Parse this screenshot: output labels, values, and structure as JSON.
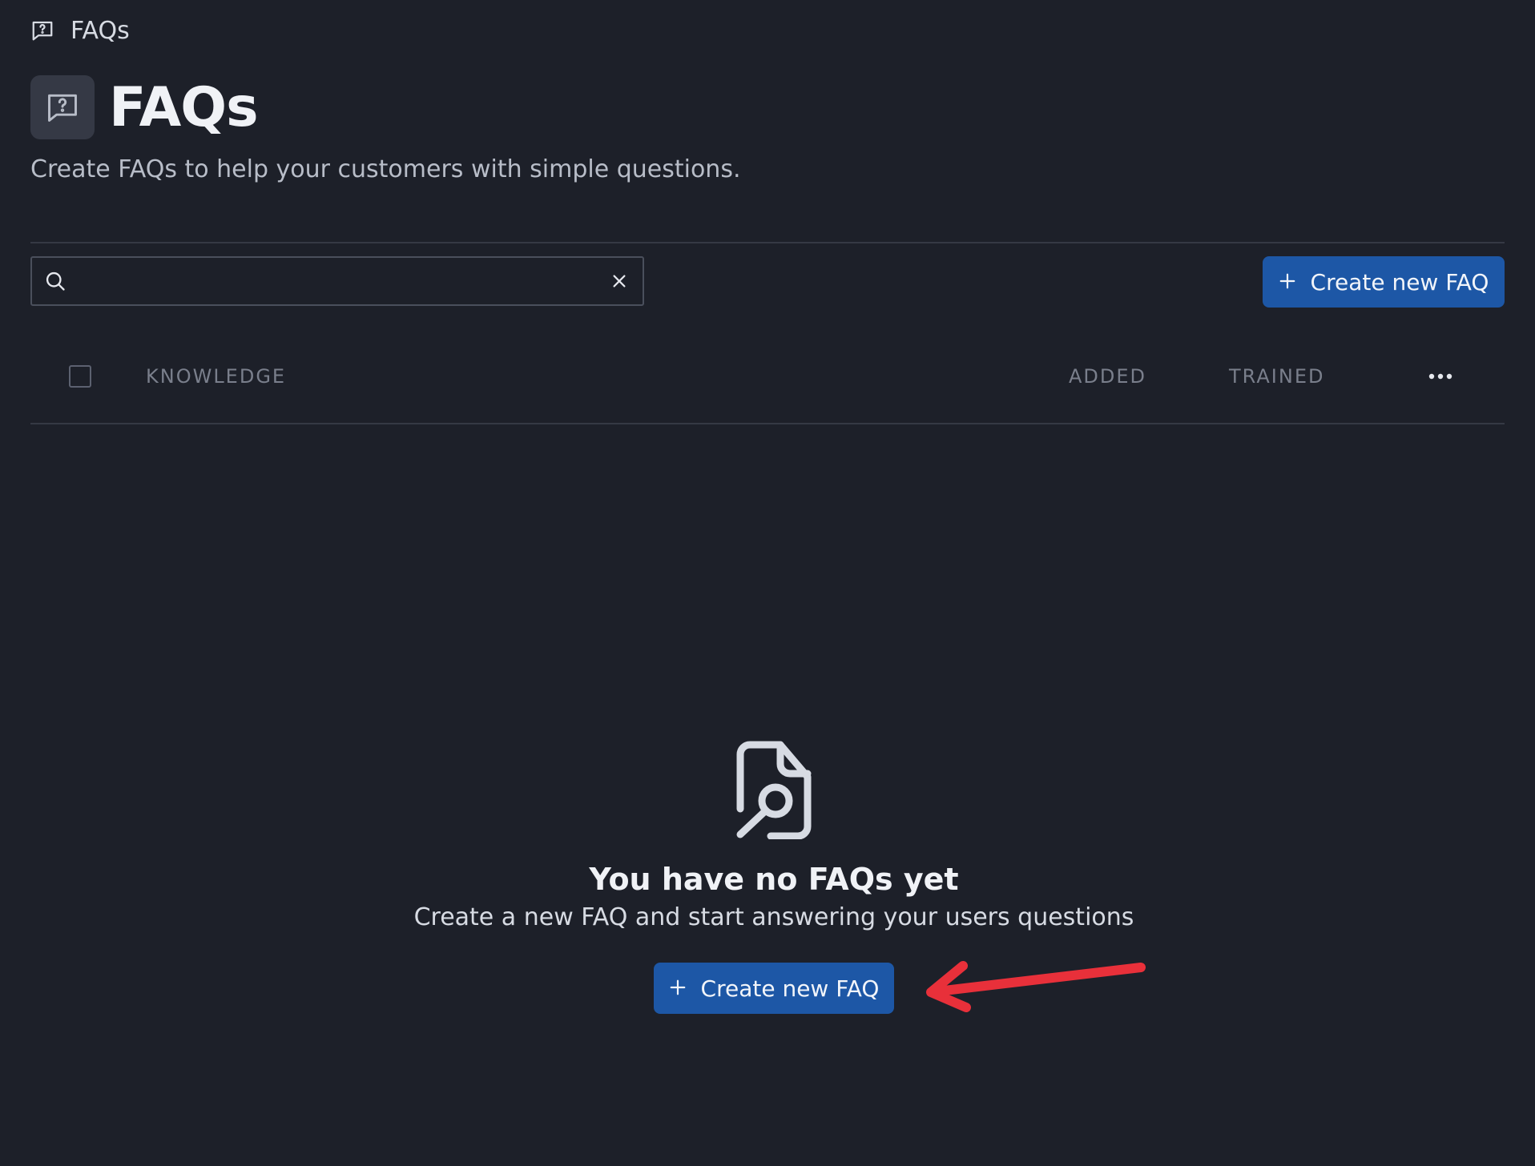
{
  "breadcrumb": {
    "label": "FAQs",
    "icon": "faq-icon"
  },
  "header": {
    "title": "FAQs",
    "subtitle": "Create FAQs to help your customers with simple questions."
  },
  "search": {
    "value": "",
    "placeholder": ""
  },
  "toolbar": {
    "create_label": "Create new FAQ"
  },
  "table": {
    "columns": [
      "KNOWLEDGE",
      "ADDED",
      "TRAINED"
    ]
  },
  "empty_state": {
    "icon": "file-search-icon",
    "title": "You have no FAQs yet",
    "description": "Create a new FAQ and start answering your users questions",
    "button_label": "Create new FAQ"
  },
  "colors": {
    "background": "#1d2029",
    "primary_button": "#1d57a6",
    "annotation_arrow": "#e8303a"
  }
}
